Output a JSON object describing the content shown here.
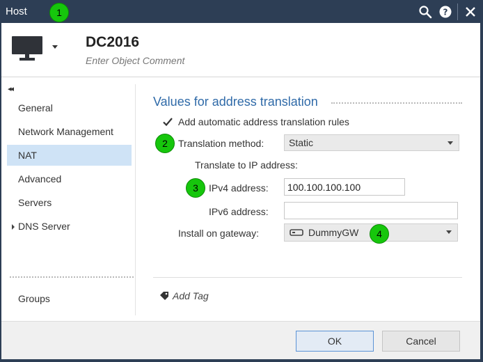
{
  "titlebar": {
    "title": "Host",
    "icons": [
      "search-icon",
      "help-icon",
      "close-icon"
    ]
  },
  "badges": [
    "1",
    "2",
    "3",
    "4"
  ],
  "header": {
    "object_name": "DC2016",
    "comment_placeholder": "Enter Object Comment",
    "icon": "monitor-icon"
  },
  "sidebar": {
    "items": [
      {
        "label": "General"
      },
      {
        "label": "Network Management"
      },
      {
        "label": "NAT"
      },
      {
        "label": "Advanced"
      },
      {
        "label": "Servers"
      },
      {
        "label": "DNS Server"
      }
    ],
    "groups_label": "Groups",
    "active": "NAT"
  },
  "nat": {
    "section_title": "Values for address translation",
    "auto_rules_label": "Add automatic address translation rules",
    "auto_rules_checked": true,
    "method_label": "Translation method:",
    "method_value": "Static",
    "translate_to_label": "Translate to IP address:",
    "ipv4_label": "IPv4 address:",
    "ipv4_value": "100.100.100.100",
    "ipv6_label": "IPv6 address:",
    "ipv6_value": "",
    "gateway_label": "Install on gateway:",
    "gateway_value": "DummyGW"
  },
  "tags": {
    "add_tag_label": "Add Tag"
  },
  "footer": {
    "ok_label": "OK",
    "cancel_label": "Cancel"
  },
  "colors": {
    "titlebar": "#2d3e55",
    "accent": "#2f6aa8",
    "active_nav": "#cfe3f6",
    "badge": "#16c60c"
  }
}
